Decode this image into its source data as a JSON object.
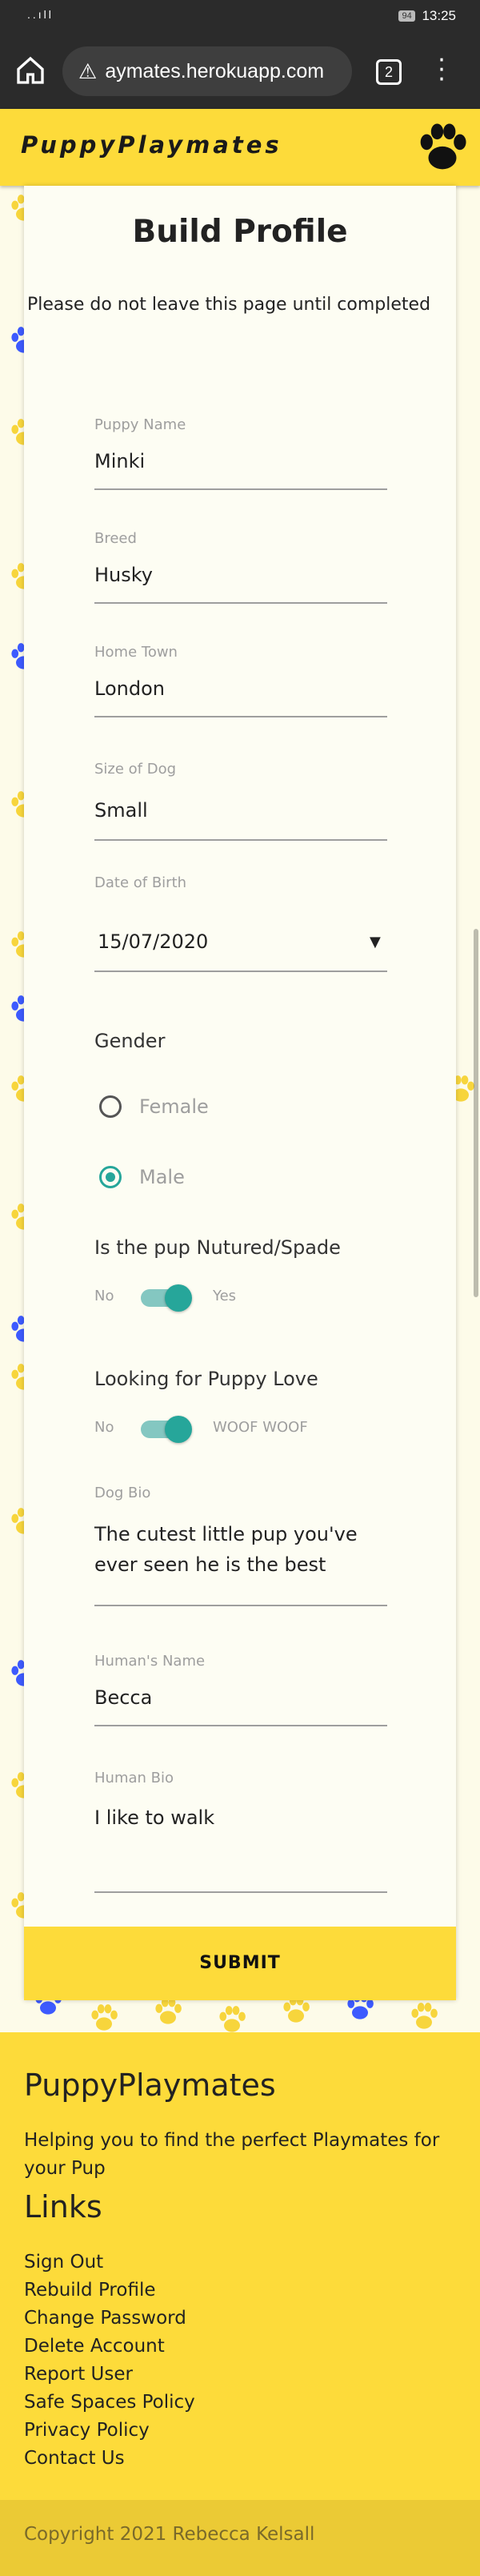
{
  "statusbar": {
    "signal": "..ıll",
    "time": "13:25",
    "battery": "94"
  },
  "browser": {
    "url": "aymates.herokuapp.com",
    "tab_count": "2"
  },
  "navbar": {
    "brand": "PuppyPlaymates"
  },
  "form": {
    "title": "Build Profile",
    "notice": "Please do not leave this page until completed",
    "puppy_name": {
      "label": "Puppy Name",
      "value": "Minki"
    },
    "breed": {
      "label": "Breed",
      "value": "Husky"
    },
    "home_town": {
      "label": "Home Town",
      "value": "London"
    },
    "size": {
      "label": "Size of Dog",
      "value": "Small"
    },
    "dob": {
      "label": "Date of Birth",
      "value": "15/07/2020"
    },
    "gender": {
      "label": "Gender",
      "options": [
        "Female",
        "Male"
      ],
      "selected": "Male"
    },
    "neutered": {
      "label": "Is the pup Nutured/Spade",
      "off": "No",
      "on": "Yes",
      "checked": true
    },
    "puppy_love": {
      "label": "Looking for Puppy Love",
      "off": "No",
      "on": "WOOF WOOF",
      "checked": true
    },
    "dog_bio": {
      "label": "Dog Bio",
      "value_line1": "The cutest little pup you've",
      "value_line2": "ever seen he is the best"
    },
    "human_name": {
      "label": "Human's Name",
      "value": "Becca"
    },
    "human_bio": {
      "label": "Human Bio",
      "value": "I like to walk"
    },
    "submit": "SUBMIT"
  },
  "footer": {
    "title": "PuppyPlaymates",
    "text": "Helping you to find the perfect Playmates for your Pup",
    "links_title": "Links",
    "links": [
      "Sign Out",
      "Rebuild Profile",
      "Change Password",
      "Delete Account",
      "Report User",
      "Safe Spaces Policy",
      "Privacy Policy",
      "Contact Us"
    ],
    "copyright": "Copyright 2021 Rebecca Kelsall"
  },
  "colors": {
    "accent": "#fddb3a",
    "teal": "#26a69a",
    "paw_blue": "#3d5afe",
    "paw_yellow": "#f7d53c"
  },
  "icons": {
    "home": "home-icon",
    "warning": "warning-icon",
    "menu": "more-vert-icon",
    "paw": "paw-icon"
  }
}
